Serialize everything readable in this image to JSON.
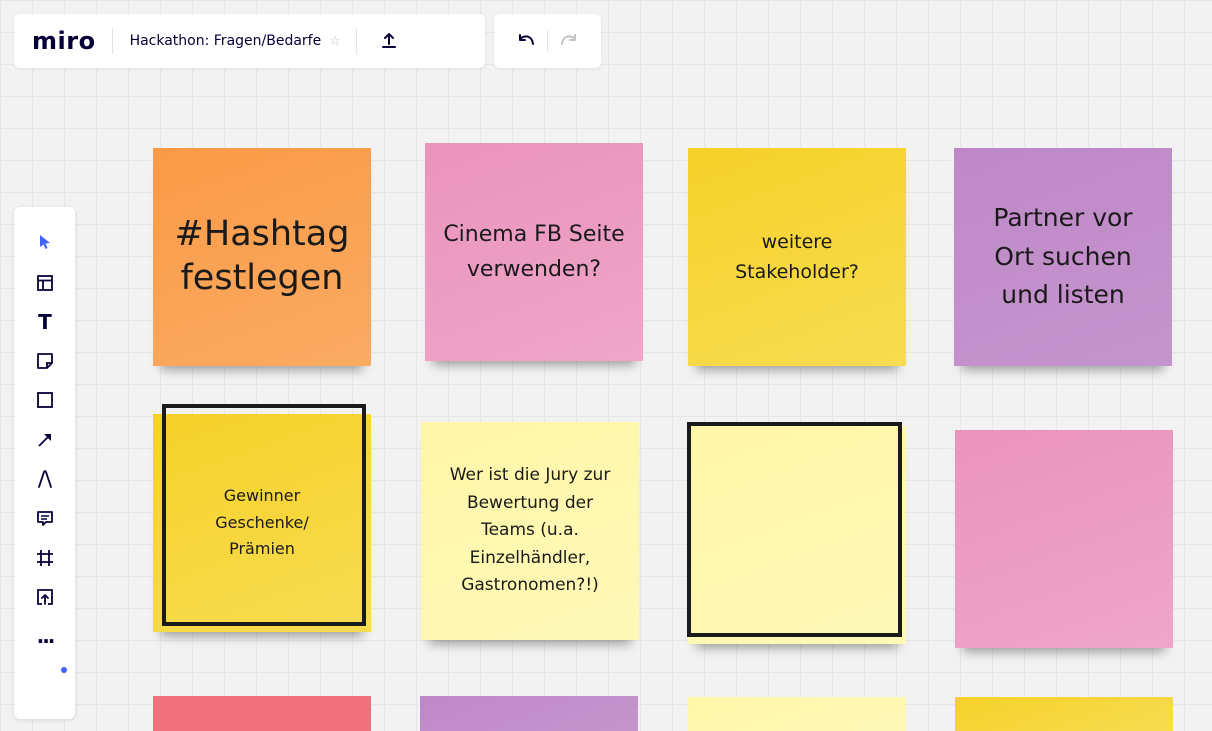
{
  "app": {
    "logo": "miro",
    "board_title": "Hackathon: Fragen/Bedarfe"
  },
  "toolbar": {
    "icons": [
      "select-icon",
      "templates-icon",
      "text-icon",
      "sticky-note-icon",
      "shape-icon",
      "connection-line-icon",
      "pen-icon",
      "comment-icon",
      "frame-icon",
      "upload-icon",
      "more-icon"
    ],
    "text_tool_glyph": "T",
    "more_glyph": "..."
  },
  "notes": {
    "n1": "#Hashtag festlegen",
    "n2": "Cinema FB Seite verwenden?",
    "n3": "weitere Stakeholder?",
    "n4": "Partner vor Ort suchen und listen",
    "n5": "Gewinner Geschenke/ Prämien",
    "n6": "Wer ist die Jury zur Bewertung der Teams (u.a. Einzelhändler, Gastronomen?!)",
    "n7": "",
    "n8": ""
  },
  "colors": {
    "orange": "#fa9a46",
    "pink": "#ea94bb",
    "yellow": "#f5d128",
    "violet": "#be88c7",
    "light_yellow": "#fff6a8",
    "red": "#f1707d",
    "accent": "#4262ff"
  }
}
